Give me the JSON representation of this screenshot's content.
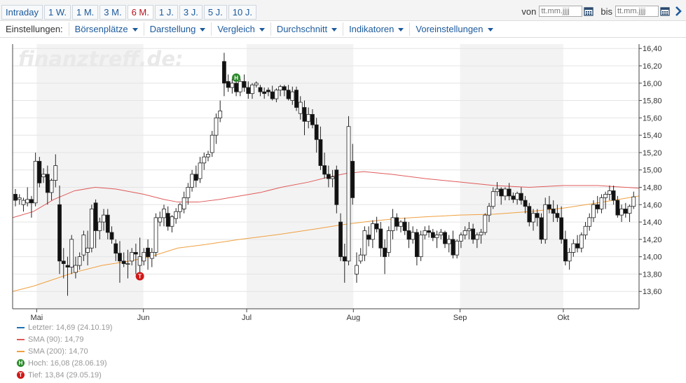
{
  "tabs": [
    {
      "label": "Intraday",
      "active": false
    },
    {
      "label": "1 W.",
      "active": false
    },
    {
      "label": "1 M.",
      "active": false
    },
    {
      "label": "3 M.",
      "active": false
    },
    {
      "label": "6 M.",
      "active": true
    },
    {
      "label": "1 J.",
      "active": false
    },
    {
      "label": "3 J.",
      "active": false
    },
    {
      "label": "5 J.",
      "active": false
    },
    {
      "label": "10 J.",
      "active": false
    }
  ],
  "range": {
    "from_label": "von",
    "from_placeholder": "tt.mm.jjjj",
    "to_label": "bis",
    "to_placeholder": "tt.mm.jjjj"
  },
  "settings": {
    "title": "Einstellungen:",
    "menus": [
      "Börsenplätze",
      "Darstellung",
      "Vergleich",
      "Durchschnitt",
      "Indikatoren",
      "Voreinstellungen"
    ]
  },
  "colors": {
    "accent": "#1c5a9c",
    "sma90": "#e05a5a",
    "sma200": "#f0a040",
    "last": "#1f6fb2",
    "high": "#2a8a2a",
    "low": "#d01818"
  },
  "watermark": "finanztreff.de:",
  "legend": {
    "last": "Letzter: 14,69 (24.10.19)",
    "sma90": "SMA (90): 14,79",
    "sma200": "SMA (200): 14,70",
    "high": "Hoch: 16,08 (28.06.19)",
    "low": "Tief: 13,84 (29.05.19)",
    "high_badge": "H",
    "low_badge": "T"
  },
  "chart_data": {
    "type": "candlestick",
    "x_ticks": [
      {
        "label": "Mai",
        "day": 7
      },
      {
        "label": "Jun",
        "day": 38
      },
      {
        "label": "Jul",
        "day": 68
      },
      {
        "label": "Aug",
        "day": 99
      },
      {
        "label": "Sep",
        "day": 130
      },
      {
        "label": "Okt",
        "day": 160
      }
    ],
    "x_range_days": [
      0,
      182
    ],
    "y_ticks": [
      "13,60",
      "13,80",
      "14,00",
      "14,20",
      "14,40",
      "14,60",
      "14,80",
      "15,00",
      "15,20",
      "15,40",
      "15,60",
      "15,80",
      "16,00",
      "16,20",
      "16,40"
    ],
    "ylim": [
      13.4,
      16.45
    ],
    "shaded_bands": [
      [
        7,
        38
      ],
      [
        68,
        99
      ],
      [
        130,
        160
      ]
    ],
    "high_marker": {
      "day": 65,
      "value": 16.08,
      "label": "H"
    },
    "low_marker": {
      "day": 36,
      "value": 13.84,
      "label": "T"
    },
    "candles_ohlc": [
      [
        14.72,
        14.78,
        14.58,
        14.65
      ],
      [
        14.66,
        14.72,
        14.6,
        14.68
      ],
      [
        14.6,
        14.68,
        14.52,
        14.65
      ],
      [
        14.62,
        14.8,
        14.58,
        14.66
      ],
      [
        14.66,
        14.7,
        14.45,
        14.62
      ],
      [
        14.62,
        15.2,
        14.58,
        15.1
      ],
      [
        15.1,
        15.15,
        14.8,
        14.85
      ],
      [
        14.92,
        15.02,
        14.85,
        14.95
      ],
      [
        14.95,
        15.05,
        14.6,
        14.74
      ],
      [
        14.74,
        14.9,
        14.65,
        14.88
      ],
      [
        14.88,
        15.18,
        14.8,
        15.05
      ],
      [
        14.6,
        14.82,
        13.8,
        13.95
      ],
      [
        13.95,
        14.1,
        13.75,
        13.92
      ],
      [
        13.9,
        14.0,
        13.55,
        13.88
      ],
      [
        13.88,
        14.25,
        13.8,
        14.2
      ],
      [
        13.82,
        14.0,
        13.75,
        13.9
      ],
      [
        13.9,
        14.05,
        13.85,
        14.0
      ],
      [
        14.02,
        14.3,
        13.95,
        14.25
      ],
      [
        14.05,
        14.3,
        13.9,
        14.1
      ],
      [
        14.1,
        14.6,
        14.05,
        14.55
      ],
      [
        14.62,
        14.66,
        14.1,
        14.3
      ],
      [
        14.3,
        14.45,
        14.2,
        14.4
      ],
      [
        14.4,
        14.55,
        14.3,
        14.48
      ],
      [
        14.48,
        14.55,
        14.2,
        14.28
      ],
      [
        14.28,
        14.35,
        14.15,
        14.2
      ],
      [
        14.15,
        14.2,
        13.95,
        14.04
      ],
      [
        14.04,
        14.18,
        13.7,
        13.95
      ],
      [
        13.95,
        14.05,
        13.88,
        13.92
      ],
      [
        13.92,
        14.08,
        13.75,
        13.92
      ],
      [
        13.95,
        14.1,
        13.9,
        14.05
      ],
      [
        14.05,
        14.15,
        13.8,
        14.03
      ],
      [
        13.9,
        14.22,
        13.75,
        14.0
      ],
      [
        13.95,
        14.1,
        13.9,
        14.05
      ],
      [
        14.1,
        14.2,
        13.85,
        14.0
      ],
      [
        13.98,
        14.1,
        13.88,
        14.05
      ],
      [
        14.05,
        14.5,
        14.0,
        14.45
      ],
      [
        14.4,
        14.52,
        14.35,
        14.45
      ],
      [
        14.45,
        14.6,
        14.35,
        14.55
      ],
      [
        14.5,
        14.58,
        14.3,
        14.35
      ],
      [
        14.35,
        14.48,
        14.28,
        14.46
      ],
      [
        14.44,
        14.56,
        14.38,
        14.52
      ],
      [
        14.52,
        14.62,
        14.44,
        14.6
      ],
      [
        14.55,
        14.75,
        14.5,
        14.68
      ],
      [
        14.68,
        14.85,
        14.6,
        14.8
      ],
      [
        14.8,
        15.0,
        14.75,
        14.95
      ],
      [
        14.95,
        15.05,
        14.8,
        14.88
      ],
      [
        14.9,
        15.15,
        14.85,
        15.08
      ],
      [
        15.08,
        15.2,
        15.0,
        15.15
      ],
      [
        15.15,
        15.22,
        15.1,
        15.18
      ],
      [
        15.2,
        15.45,
        15.15,
        15.4
      ],
      [
        15.4,
        15.65,
        15.3,
        15.6
      ],
      [
        15.6,
        15.8,
        15.55,
        15.68
      ],
      [
        16.25,
        16.35,
        15.85,
        16.0
      ],
      [
        16.02,
        16.1,
        15.9,
        15.95
      ],
      [
        15.95,
        16.05,
        15.88,
        16.0
      ],
      [
        16.0,
        16.08,
        15.85,
        15.9
      ],
      [
        15.9,
        16.05,
        15.85,
        16.02
      ],
      [
        16.02,
        16.1,
        15.9,
        15.95
      ],
      [
        15.95,
        16.02,
        15.82,
        15.88
      ],
      [
        15.88,
        16.0,
        15.82,
        15.98
      ],
      [
        15.98,
        16.02,
        15.95,
        16.0
      ],
      [
        15.95,
        15.98,
        15.85,
        15.9
      ],
      [
        15.9,
        15.95,
        15.82,
        15.88
      ],
      [
        15.92,
        15.95,
        15.85,
        15.9
      ],
      [
        15.9,
        15.97,
        15.8,
        15.82
      ],
      [
        15.82,
        15.94,
        15.78,
        15.92
      ],
      [
        15.92,
        15.98,
        15.85,
        15.96
      ],
      [
        15.96,
        15.98,
        15.85,
        15.92
      ],
      [
        15.92,
        15.98,
        15.8,
        15.82
      ],
      [
        15.8,
        15.96,
        15.75,
        15.9
      ],
      [
        15.92,
        15.96,
        15.68,
        15.72
      ],
      [
        15.65,
        15.85,
        15.58,
        15.78
      ],
      [
        15.72,
        15.8,
        15.4,
        15.56
      ],
      [
        15.56,
        15.72,
        15.48,
        15.64
      ],
      [
        15.64,
        15.7,
        15.48,
        15.52
      ],
      [
        15.52,
        15.6,
        15.2,
        15.35
      ],
      [
        15.35,
        15.5,
        15.0,
        15.05
      ],
      [
        15.05,
        15.2,
        14.9,
        14.95
      ],
      [
        14.95,
        15.05,
        14.8,
        14.9
      ],
      [
        14.9,
        15.0,
        14.8,
        14.92
      ],
      [
        15.0,
        15.05,
        14.5,
        14.6
      ],
      [
        14.4,
        14.5,
        13.95,
        14.0
      ],
      [
        14.0,
        14.15,
        13.7,
        13.95
      ],
      [
        13.95,
        15.62,
        13.9,
        15.5
      ],
      [
        15.1,
        15.3,
        14.6,
        14.68
      ],
      [
        13.8,
        14.05,
        13.7,
        13.9
      ],
      [
        13.95,
        14.1,
        13.92,
        14.02
      ],
      [
        14.02,
        14.35,
        13.95,
        14.3
      ],
      [
        14.25,
        14.35,
        14.12,
        14.2
      ],
      [
        14.2,
        14.42,
        14.1,
        14.38
      ],
      [
        14.38,
        14.46,
        14.28,
        14.32
      ],
      [
        14.32,
        14.4,
        14.0,
        14.1
      ],
      [
        14.1,
        14.2,
        13.8,
        14.0
      ],
      [
        14.05,
        14.35,
        14.0,
        14.3
      ],
      [
        14.3,
        14.55,
        14.2,
        14.45
      ],
      [
        14.45,
        14.5,
        14.3,
        14.35
      ],
      [
        14.35,
        14.42,
        14.28,
        14.4
      ],
      [
        14.4,
        14.45,
        14.25,
        14.3
      ],
      [
        14.3,
        14.4,
        14.1,
        14.2
      ],
      [
        14.2,
        14.35,
        14.15,
        14.28
      ],
      [
        14.28,
        14.32,
        13.9,
        14.0
      ],
      [
        14.0,
        14.3,
        13.95,
        14.25
      ],
      [
        14.25,
        14.35,
        14.2,
        14.3
      ],
      [
        14.3,
        14.36,
        14.22,
        14.28
      ],
      [
        14.28,
        14.32,
        14.18,
        14.22
      ],
      [
        14.22,
        14.3,
        14.1,
        14.25
      ],
      [
        14.25,
        14.32,
        14.2,
        14.28
      ],
      [
        14.28,
        14.3,
        14.1,
        14.15
      ],
      [
        14.15,
        14.25,
        14.05,
        14.2
      ],
      [
        14.2,
        14.3,
        13.98,
        14.02
      ],
      [
        14.02,
        14.2,
        13.98,
        14.18
      ],
      [
        14.18,
        14.28,
        14.1,
        14.25
      ],
      [
        14.25,
        14.35,
        14.2,
        14.3
      ],
      [
        14.3,
        14.4,
        14.2,
        14.32
      ],
      [
        14.32,
        14.38,
        14.15,
        14.2
      ],
      [
        14.2,
        14.28,
        14.1,
        14.25
      ],
      [
        14.25,
        14.32,
        14.15,
        14.28
      ],
      [
        14.28,
        14.5,
        14.25,
        14.48
      ],
      [
        14.48,
        14.62,
        14.4,
        14.58
      ],
      [
        14.58,
        14.8,
        14.55,
        14.75
      ],
      [
        14.75,
        14.86,
        14.7,
        14.78
      ],
      [
        14.78,
        14.8,
        14.6,
        14.7
      ],
      [
        14.7,
        14.8,
        14.65,
        14.78
      ],
      [
        14.78,
        14.85,
        14.65,
        14.7
      ],
      [
        14.7,
        14.74,
        14.62,
        14.66
      ],
      [
        14.66,
        14.75,
        14.6,
        14.73
      ],
      [
        14.73,
        14.8,
        14.6,
        14.65
      ],
      [
        14.65,
        14.7,
        14.5,
        14.58
      ],
      [
        14.58,
        14.62,
        14.35,
        14.4
      ],
      [
        14.4,
        14.55,
        14.3,
        14.5
      ],
      [
        14.5,
        14.55,
        14.35,
        14.45
      ],
      [
        14.45,
        14.5,
        14.15,
        14.2
      ],
      [
        14.2,
        14.68,
        14.15,
        14.6
      ],
      [
        14.6,
        14.7,
        14.5,
        14.55
      ],
      [
        14.55,
        14.65,
        14.4,
        14.5
      ],
      [
        14.5,
        14.6,
        14.4,
        14.45
      ],
      [
        14.45,
        14.58,
        14.15,
        14.2
      ],
      [
        14.2,
        14.3,
        13.9,
        13.95
      ],
      [
        13.95,
        14.1,
        13.85,
        14.05
      ],
      [
        14.05,
        14.2,
        14.0,
        14.15
      ],
      [
        14.15,
        14.25,
        14.05,
        14.1
      ],
      [
        14.1,
        14.28,
        14.05,
        14.25
      ],
      [
        14.25,
        14.4,
        14.2,
        14.35
      ],
      [
        14.35,
        14.5,
        14.3,
        14.45
      ],
      [
        14.45,
        14.65,
        14.4,
        14.6
      ],
      [
        14.6,
        14.7,
        14.5,
        14.55
      ],
      [
        14.55,
        14.72,
        14.5,
        14.68
      ],
      [
        14.68,
        14.75,
        14.55,
        14.72
      ],
      [
        14.72,
        14.82,
        14.65,
        14.76
      ],
      [
        14.76,
        14.82,
        14.6,
        14.65
      ],
      [
        14.65,
        14.7,
        14.45,
        14.48
      ],
      [
        14.48,
        14.6,
        14.4,
        14.55
      ],
      [
        14.55,
        14.62,
        14.45,
        14.5
      ],
      [
        14.5,
        14.6,
        14.4,
        14.58
      ],
      [
        14.58,
        14.75,
        14.55,
        14.69
      ]
    ],
    "sma90": [
      [
        0,
        14.45
      ],
      [
        6,
        14.52
      ],
      [
        12,
        14.66
      ],
      [
        18,
        14.76
      ],
      [
        24,
        14.8
      ],
      [
        30,
        14.78
      ],
      [
        38,
        14.72
      ],
      [
        44,
        14.66
      ],
      [
        48,
        14.63
      ],
      [
        54,
        14.63
      ],
      [
        60,
        14.66
      ],
      [
        66,
        14.7
      ],
      [
        72,
        14.74
      ],
      [
        78,
        14.8
      ],
      [
        86,
        14.86
      ],
      [
        92,
        14.92
      ],
      [
        97,
        14.96
      ],
      [
        102,
        14.98
      ],
      [
        110,
        14.95
      ],
      [
        120,
        14.9
      ],
      [
        130,
        14.86
      ],
      [
        140,
        14.82
      ],
      [
        150,
        14.8
      ],
      [
        160,
        14.82
      ],
      [
        170,
        14.82
      ],
      [
        182,
        14.79
      ]
    ],
    "sma200": [
      [
        0,
        13.6
      ],
      [
        6,
        13.66
      ],
      [
        12,
        13.74
      ],
      [
        18,
        13.82
      ],
      [
        26,
        13.9
      ],
      [
        34,
        13.95
      ],
      [
        40,
        14.0
      ],
      [
        48,
        14.1
      ],
      [
        56,
        14.14
      ],
      [
        66,
        14.2
      ],
      [
        78,
        14.26
      ],
      [
        88,
        14.32
      ],
      [
        96,
        14.37
      ],
      [
        104,
        14.41
      ],
      [
        112,
        14.44
      ],
      [
        120,
        14.46
      ],
      [
        130,
        14.48
      ],
      [
        140,
        14.49
      ],
      [
        150,
        14.52
      ],
      [
        160,
        14.56
      ],
      [
        170,
        14.62
      ],
      [
        182,
        14.7
      ]
    ]
  }
}
